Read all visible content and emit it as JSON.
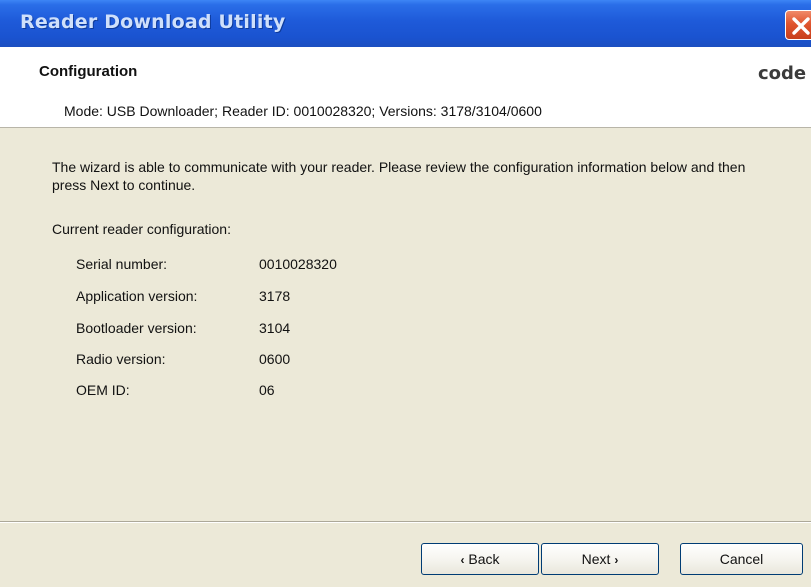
{
  "window": {
    "title": "Reader Download Utility",
    "close_icon": "close-icon"
  },
  "header": {
    "title": "Configuration",
    "brand": "code",
    "mode_line": "Mode: USB Downloader; Reader ID: 0010028320; Versions: 3178/3104/0600"
  },
  "main": {
    "intro": "The wizard is able to communicate with your reader.  Please review the configuration information below and then press Next to continue.",
    "config_label": "Current reader configuration:",
    "rows": [
      {
        "key": "Serial number:",
        "value": "0010028320"
      },
      {
        "key": "Application version:",
        "value": "3178"
      },
      {
        "key": "Bootloader version:",
        "value": "3104"
      },
      {
        "key": "Radio version:",
        "value": "0600"
      },
      {
        "key": "OEM ID:",
        "value": "06"
      }
    ]
  },
  "footer": {
    "back_label": "Back",
    "back_icon": "chevron-left-icon",
    "next_label": "Next",
    "next_icon": "chevron-right-icon",
    "cancel_label": "Cancel"
  },
  "colors": {
    "titlebar": "#1e5ad9",
    "dialog_bg": "#ece9d8",
    "close_button": "#e0552f"
  }
}
